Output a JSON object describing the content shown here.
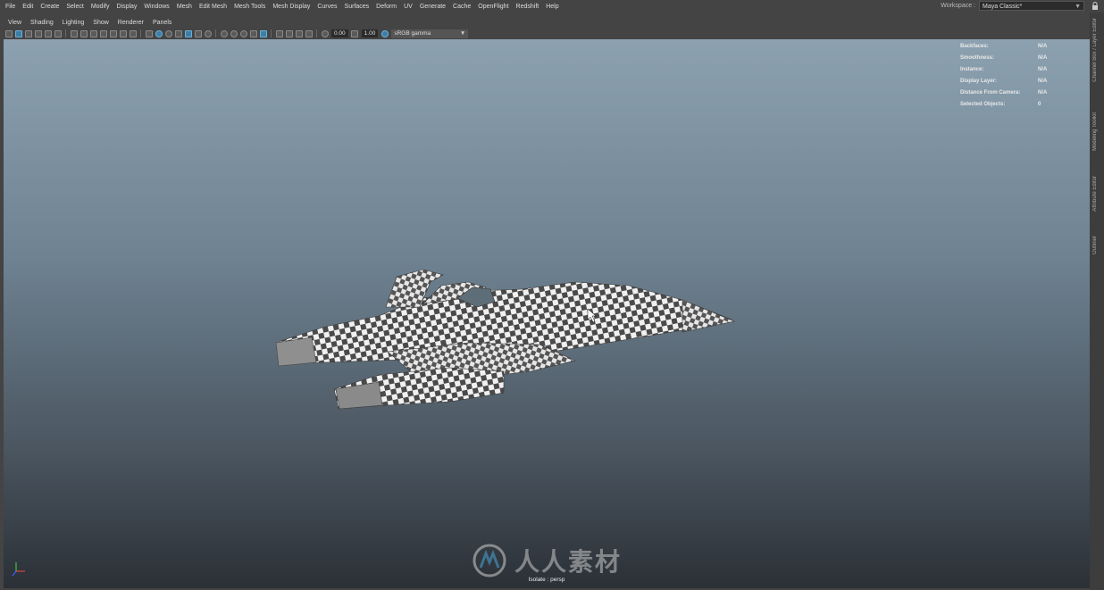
{
  "menubar": {
    "items": [
      "File",
      "Edit",
      "Create",
      "Select",
      "Modify",
      "Display",
      "Windows",
      "Mesh",
      "Edit Mesh",
      "Mesh Tools",
      "Mesh Display",
      "Curves",
      "Surfaces",
      "Deform",
      "UV",
      "Generate",
      "Cache",
      "OpenFlight",
      "Redshift",
      "Help"
    ]
  },
  "workspace": {
    "label": "Workspace :",
    "value": "Maya Classic*"
  },
  "panel_menu": {
    "items": [
      "View",
      "Shading",
      "Lighting",
      "Show",
      "Renderer",
      "Panels"
    ]
  },
  "toolbar": {
    "exposure": "0.00",
    "gamma": "1.00",
    "color_space": "sRGB gamma"
  },
  "hud": {
    "rows": [
      {
        "label": "Backfaces:",
        "value": "N/A"
      },
      {
        "label": "Smoothness:",
        "value": "N/A"
      },
      {
        "label": "Instance:",
        "value": "N/A"
      },
      {
        "label": "Display Layer:",
        "value": "N/A"
      },
      {
        "label": "Distance From Camera:",
        "value": "N/A"
      },
      {
        "label": "Selected Objects:",
        "value": "0"
      }
    ]
  },
  "viewport": {
    "isolate": "Isolate : persp"
  },
  "watermark": {
    "text": "人人素材"
  },
  "side_tabs": [
    "Channel Box / Layer Editor",
    "Modeling Toolkit",
    "Attribute Editor",
    "Outliner"
  ],
  "colors": {
    "accent": "#3d7ea6",
    "viewport_top": "#8ca1b0",
    "viewport_bottom": "#2b3036"
  }
}
